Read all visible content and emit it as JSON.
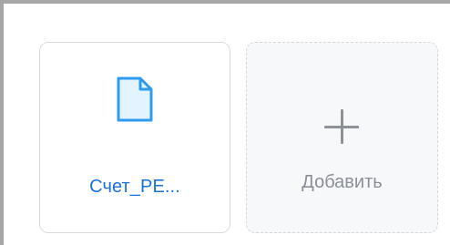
{
  "attachments": {
    "file": {
      "name": "Счет_PE...",
      "icon": "file-icon"
    },
    "add": {
      "label": "Добавить",
      "icon": "plus-icon"
    }
  },
  "colors": {
    "file_accent": "#1a73d9",
    "file_fill": "#e3f3ff",
    "muted_text": "#8b9098"
  }
}
